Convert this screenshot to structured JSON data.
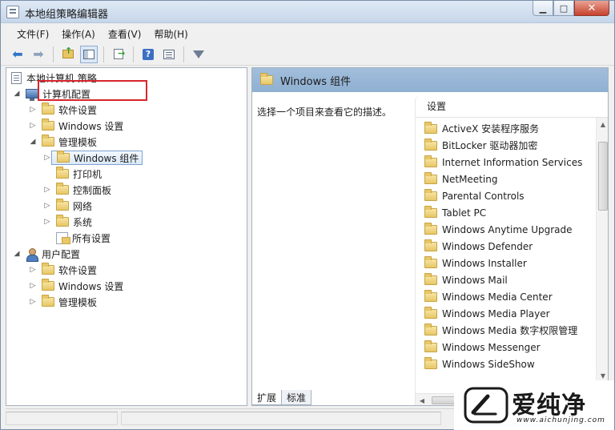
{
  "window": {
    "title": "本地组策略编辑器",
    "controls": {
      "minimize": "▁",
      "maximize": "□",
      "close": "✕"
    }
  },
  "menu": [
    "文件(F)",
    "操作(A)",
    "查看(V)",
    "帮助(H)"
  ],
  "toolbar": {
    "icons": [
      "back-arrow-icon",
      "forward-arrow-icon",
      "folder-up-icon",
      "show-hide-pane-icon",
      "export-list-icon",
      "help-icon",
      "properties-icon",
      "filter-icon"
    ]
  },
  "tree": {
    "root": "本地计算机 策略",
    "computer_config": "计算机配置",
    "cc_software": "软件设置",
    "cc_windows": "Windows 设置",
    "cc_admin": "管理模板",
    "windows_components": "Windows 组件",
    "printers": "打印机",
    "control_panel": "控制面板",
    "network": "网络",
    "system": "系统",
    "all_settings": "所有设置",
    "user_config": "用户配置",
    "uc_software": "软件设置",
    "uc_windows": "Windows 设置",
    "uc_admin": "管理模板"
  },
  "right": {
    "header_title": "Windows 组件",
    "description": "选择一个项目来查看它的描述。",
    "column_header": "设置",
    "items": [
      "ActiveX 安装程序服务",
      "BitLocker 驱动器加密",
      "Internet Information Services",
      "NetMeeting",
      "Parental Controls",
      "Tablet PC",
      "Windows Anytime Upgrade",
      "Windows Defender",
      "Windows Installer",
      "Windows Mail",
      "Windows Media Center",
      "Windows Media Player",
      "Windows Media 数字权限管理",
      "Windows Messenger",
      "Windows SideShow"
    ]
  },
  "tabs": {
    "extended": "扩展",
    "standard": "标准"
  },
  "watermark": {
    "title": "爱纯净",
    "url": "www.aichunjing.com"
  },
  "colors": {
    "highlight_box": "#d7262b",
    "header_band": "#9bb8d8"
  }
}
